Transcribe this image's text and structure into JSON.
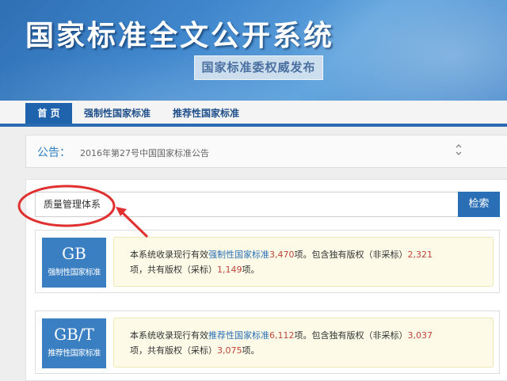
{
  "header": {
    "title": "国家标准全文公开系统",
    "subtitle": "国家标准委权威发布"
  },
  "nav": {
    "items": [
      {
        "label": "首 页",
        "active": true
      },
      {
        "label": "强制性国家标准",
        "active": false
      },
      {
        "label": "推荐性国家标准",
        "active": false
      }
    ]
  },
  "announcement": {
    "label": "公告：",
    "text": "2016年第27号中国国家标准公告",
    "toggle_icon": "up-down-chevron-icon"
  },
  "search": {
    "value": "质量管理体系",
    "button_label": "检索"
  },
  "cards": [
    {
      "code": "GB",
      "name": "强制性国家标准",
      "text_prefix": "本系统收录现行有效",
      "link_text": "强制性国家标准",
      "total": "3,470",
      "text_mid1": "项。包含独有版权（非采标）",
      "exclusive": "2,321",
      "text_mid2": "项，共有版权（采标）",
      "shared": "1,149",
      "text_end": "项。"
    },
    {
      "code": "GB/T",
      "name": "推荐性国家标准",
      "text_prefix": "本系统收录现行有效",
      "link_text": "推荐性国家标准",
      "total": "6,112",
      "text_mid1": "项。包含独有版权（非采标）",
      "exclusive": "3,037",
      "text_mid2": "项，共有版权（采标）",
      "shared": "3,075",
      "text_end": "项。"
    }
  ],
  "colors": {
    "brand_blue": "#1e63ac",
    "number_red": "#c0443a",
    "annotation_red": "#e03030"
  }
}
